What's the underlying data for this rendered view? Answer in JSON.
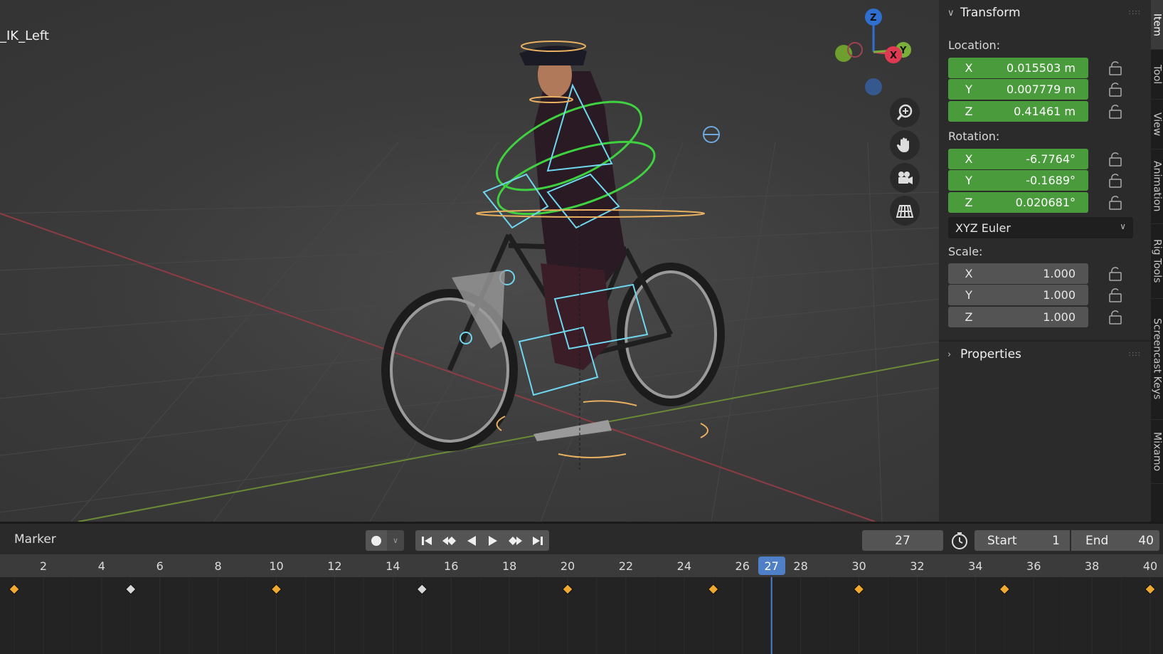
{
  "viewport": {
    "object_name": "_IK_Left",
    "gizmo": {
      "z": "Z",
      "x": "X",
      "y": "Y"
    },
    "nav_icons": [
      "zoom-icon",
      "pan-hand-icon",
      "camera-icon",
      "grid-icon"
    ]
  },
  "side_tabs": [
    "Item",
    "Tool",
    "View",
    "Animation",
    "Rig Tools",
    "Screencast Keys",
    "Mixamo"
  ],
  "transform": {
    "title": "Transform",
    "location_label": "Location:",
    "location": [
      {
        "axis": "X",
        "value": "0.015503 m"
      },
      {
        "axis": "Y",
        "value": "0.007779 m"
      },
      {
        "axis": "Z",
        "value": "0.41461 m"
      }
    ],
    "rotation_label": "Rotation:",
    "rotation": [
      {
        "axis": "X",
        "value": "-6.7764°"
      },
      {
        "axis": "Y",
        "value": "-0.1689°"
      },
      {
        "axis": "Z",
        "value": "0.020681°"
      }
    ],
    "rotation_mode": "XYZ Euler",
    "scale_label": "Scale:",
    "scale": [
      {
        "axis": "X",
        "value": "1.000"
      },
      {
        "axis": "Y",
        "value": "1.000"
      },
      {
        "axis": "Z",
        "value": "1.000"
      }
    ]
  },
  "properties": {
    "title": "Properties"
  },
  "timeline": {
    "marker_label": "Marker",
    "current_frame": "27",
    "start_label": "Start",
    "start_value": "1",
    "end_label": "End",
    "end_value": "40",
    "ticks": [
      "2",
      "4",
      "6",
      "8",
      "10",
      "12",
      "14",
      "16",
      "18",
      "20",
      "22",
      "24",
      "26",
      "28",
      "30",
      "32",
      "34",
      "36",
      "38",
      "40"
    ],
    "current_tick": "27",
    "keyframes_selected": [
      1,
      10,
      20,
      25,
      30,
      35,
      40
    ],
    "keyframes_unselected": [
      5,
      15
    ],
    "colors": {
      "selected_key": "#f0a830",
      "unselected_key": "#d8d8d8",
      "playhead": "#4f7fc7"
    }
  }
}
